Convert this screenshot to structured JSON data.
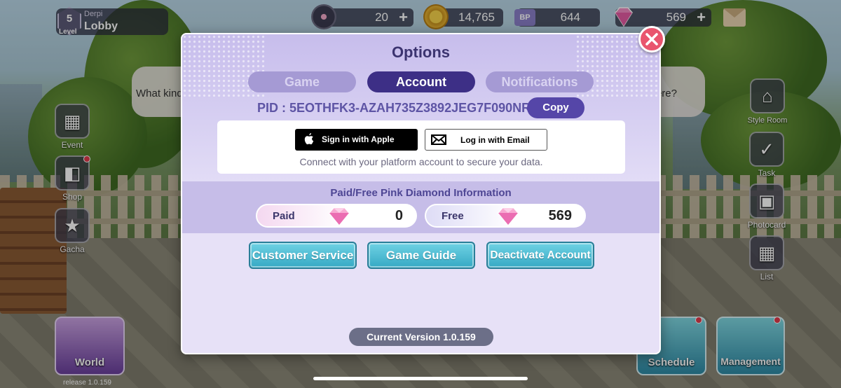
{
  "hud": {
    "level_number": "5",
    "level_label": "Level",
    "username": "Derpi",
    "location": "Lobby",
    "currencies": [
      {
        "icon": "disc-icon",
        "value": "20",
        "has_plus": true
      },
      {
        "icon": "gold-coin-icon",
        "value": "14,765",
        "has_plus": false
      },
      {
        "icon": "bp-ticket-icon",
        "value": "644",
        "has_plus": false
      },
      {
        "icon": "pink-diamond-icon",
        "value": "569",
        "has_plus": true
      }
    ],
    "plus": "+"
  },
  "side_left": [
    {
      "label": "Event",
      "icon": "calendar-icon"
    },
    {
      "label": "Shop",
      "icon": "shopping-bag-icon"
    },
    {
      "label": "Gacha",
      "icon": "cards-icon"
    }
  ],
  "side_right": [
    {
      "label": "Style Room",
      "icon": "hanger-icon"
    },
    {
      "label": "Task",
      "icon": "clipboard-icon"
    },
    {
      "label": "Photocard",
      "icon": "camera-icon"
    },
    {
      "label": "List",
      "icon": "grid-icon"
    }
  ],
  "bottom": {
    "world_label": "World",
    "schedule_label": "Schedule",
    "management_label": "Management",
    "release": "release 1.0.159"
  },
  "speech": {
    "left": "What kind",
    "right": "ere?"
  },
  "modal": {
    "title": "Options",
    "tabs": [
      {
        "label": "Game",
        "active": false
      },
      {
        "label": "Account",
        "active": true
      },
      {
        "label": "Notifications",
        "active": false
      }
    ],
    "pid": "PID : 5EOTHFK3-AZAH735Z3892JEG7F090NRT",
    "copy_label": "Copy",
    "apple_label": "Sign in with Apple",
    "email_label": "Log in with Email",
    "login_note": "Connect with your platform account to secure your data.",
    "diamond_title": "Paid/Free Pink Diamond Information",
    "paid_label": "Paid",
    "paid_value": "0",
    "free_label": "Free",
    "free_value": "569",
    "buttons": [
      "Customer Service",
      "Game Guide",
      "Deactivate Account"
    ],
    "version": "Current Version 1.0.159"
  },
  "colors": {
    "accent": "#3d2f86",
    "teal_button": "#36a9c4",
    "close": "#e9556e",
    "diamond": "#f06eb4"
  }
}
